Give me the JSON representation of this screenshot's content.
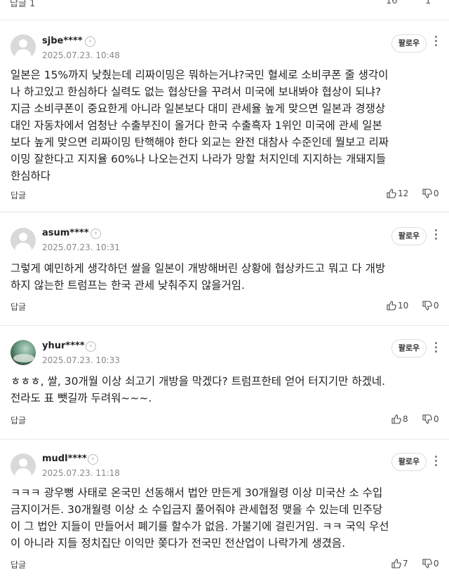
{
  "top_partial": {
    "reply_label": "답글 1",
    "likes": "16",
    "dislikes": "1"
  },
  "follow_label": "팔로우",
  "reply_label": "답글",
  "comments": [
    {
      "username": "sjbe****",
      "date": "2025.07.23. 10:48",
      "lines": [
        "일본은 15%까지 낮췄는데 리짜이밍은 뭐하는거냐?국민 혈세로 소비쿠폰 줄 생각이",
        "나 하고있고 한심하다 실력도 없는 협상단을 꾸려서 미국에 보내봐야 협상이 되냐?",
        "지금 소비쿠폰이 중요한게 아니라 일본보다 대미 관세율 높게 맞으면 일본과 경쟁상",
        "대인 자동차에서 엄청난 수출부진이 올거다 한국 수출흑자 1위인 미국에 관세 일본",
        "보다 높게 맞으면 리짜이밍 탄핵해야 한다 외교는 완전 대참사 수준인데 뭘보고 리짜",
        "이밍 잘한다고 지지율 60%나 나오는건지 나라가 망할 처지인데 지지하는 개돼지들",
        "한심하다"
      ],
      "likes": "12",
      "dislikes": "0"
    },
    {
      "username": "asum****",
      "date": "2025.07.23. 10:31",
      "lines": [
        "그렇게 예민하게 생각하던 쌀을 일본이 개방해버린 상황에 협상카드고 뭐고 다 개방",
        "하지 않는한 트럼프는 한국 관세 낮춰주지 않을거임."
      ],
      "likes": "10",
      "dislikes": "0"
    },
    {
      "username": "yhur****",
      "date": "2025.07.23. 10:33",
      "lines": [
        "ㅎㅎㅎ, 쌀, 30개월 이상 쇠고기 개방을 막겠다? 트럼프한테 얻어 터지기만 하겠네.",
        "전라도 표 뺏길까 두려워~~~."
      ],
      "likes": "8",
      "dislikes": "0"
    },
    {
      "username": "mudl****",
      "date": "2025.07.23. 11:18",
      "lines": [
        "ㅋㅋㅋ 광우뻥 사태로 온국민 선동해서 법안 만든게 30개월령 이상 미국산 소 수입",
        "금지이거든. 30개월령 이상 소 수입금지 풀어줘야 관세협정 맺을 수 있는데 민주당",
        "이 그 법안 지들이 만들어서 폐기를 할수가 없음. 가불기에 걸린거임. ㅋㅋ 국익 우선",
        "이 아니라 지들 정치집단 이익만 쫒다가 전국민 전산업이 나락가게 생겼음."
      ],
      "likes": "7",
      "dislikes": "0"
    }
  ],
  "icons": {
    "like": "thumbs-up-icon",
    "dislike": "thumbs-down-icon"
  }
}
